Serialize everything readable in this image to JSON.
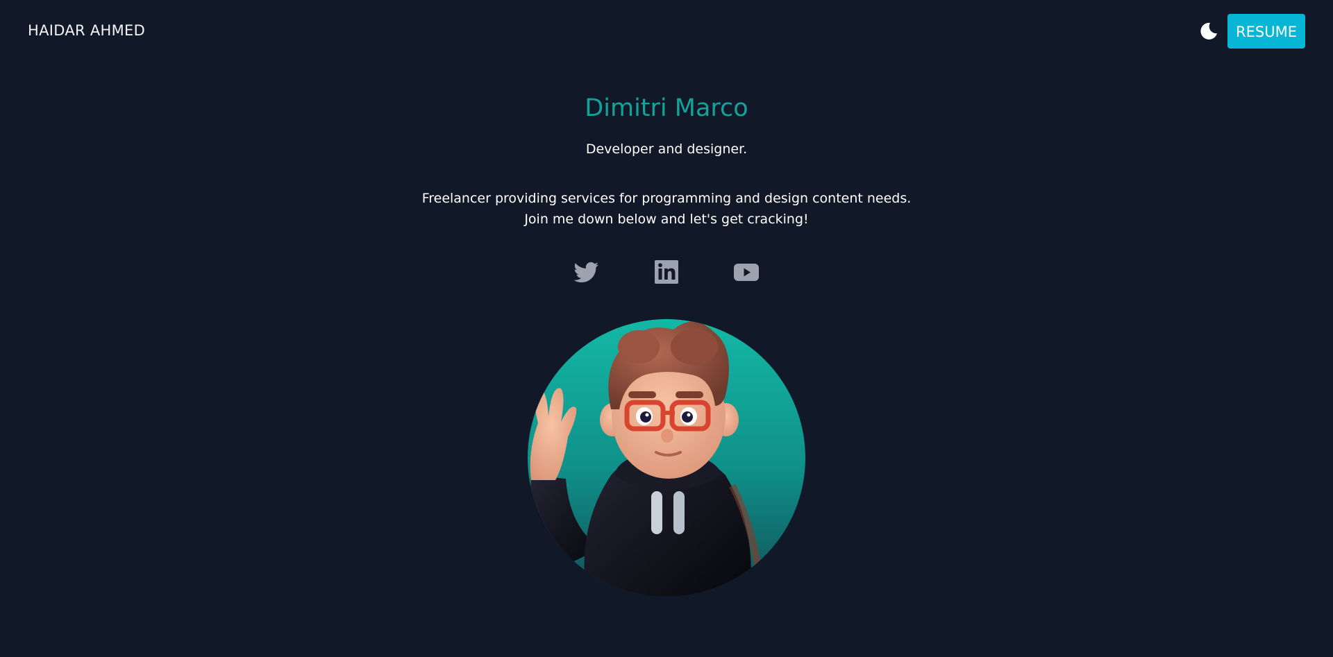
{
  "navbar": {
    "brand": "HAIDAR AHMED",
    "theme_icon": "moon-icon",
    "resume_label": "RESUME"
  },
  "hero": {
    "name": "Dimitri Marco",
    "role": "Developer and designer.",
    "description_line1": "Freelancer providing services for programming and design content needs.",
    "description_line2": "Join me down below and let's get cracking!"
  },
  "socials": [
    {
      "icon": "twitter-icon"
    },
    {
      "icon": "linkedin-icon"
    },
    {
      "icon": "youtube-icon"
    }
  ],
  "colors": {
    "background": "#111827",
    "accent": "#14a39a",
    "button": "#06b6d4",
    "icon": "#9ca3af"
  }
}
